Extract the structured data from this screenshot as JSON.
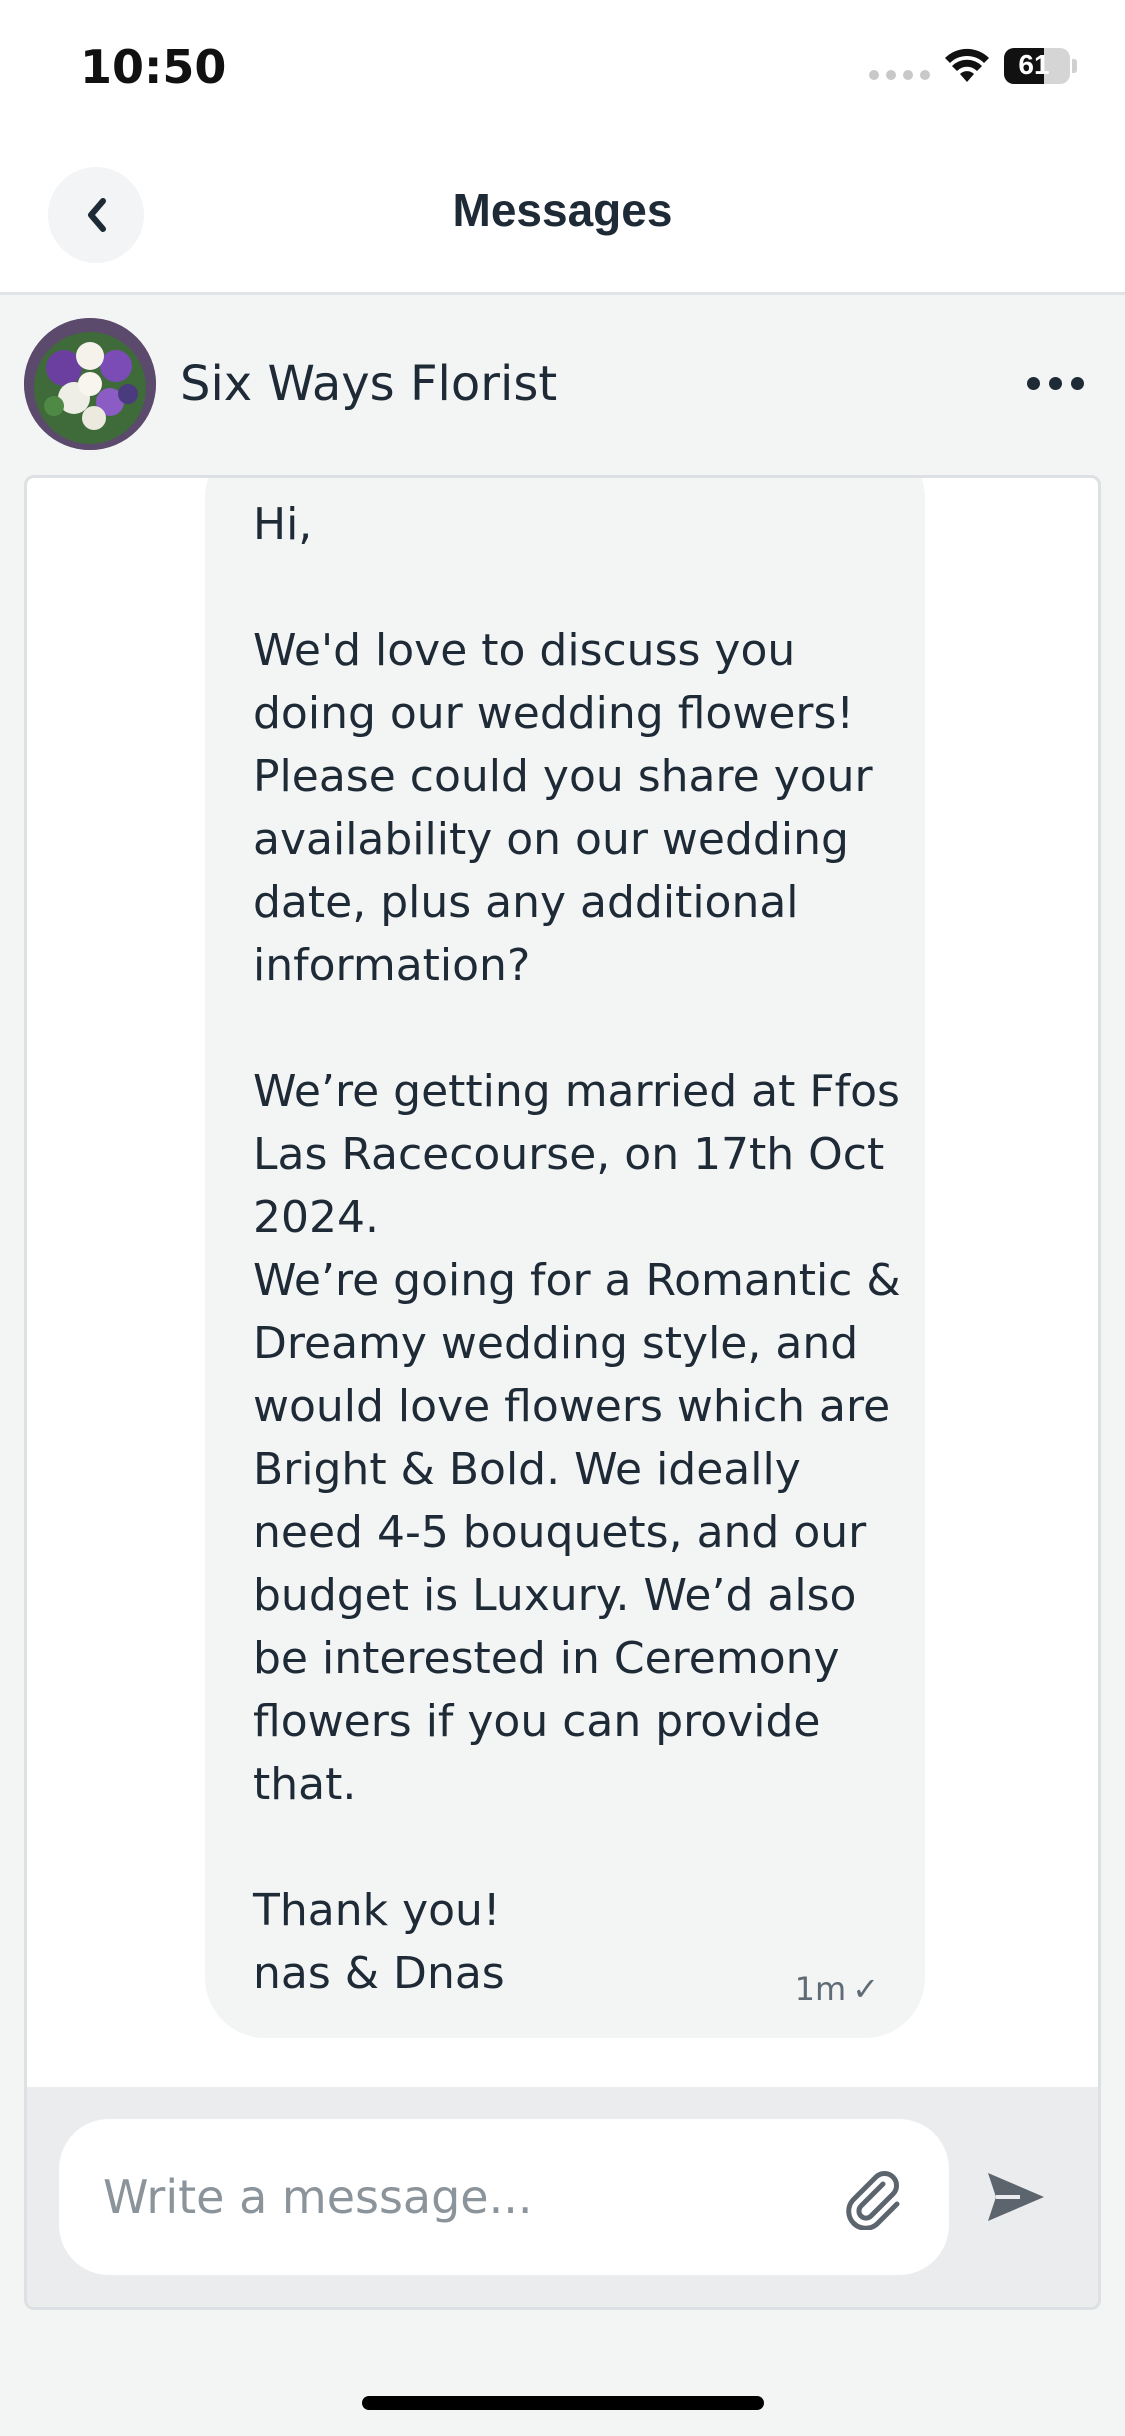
{
  "status_bar": {
    "time": "10:50",
    "battery_level": "61",
    "battery_fraction": 0.61,
    "icons": [
      "signal-icon",
      "wifi-icon",
      "battery-icon"
    ]
  },
  "header": {
    "title": "Messages",
    "back_icon": "chevron-left-icon"
  },
  "contact": {
    "name": "Six Ways Florist",
    "avatar": "florist-avatar",
    "more_icon": "more-horizontal-icon"
  },
  "message": {
    "text": "Hi,\n\nWe'd love to discuss you doing our wedding flowers! Please could you share your availability on our wedding date, plus any additional information?\n\nWe’re getting married at Ffos Las Racecourse, on 17th Oct 2024.\nWe’re going for a Romantic & Dreamy wedding style, and would love flowers which are Bright & Bold. We ideally need 4-5 bouquets, and our budget is Luxury. We’d also be interested in Ceremony flowers if you can provide that.\n\nThank you!\nnas & Dnas",
    "time": "1m",
    "status_mark": "✓"
  },
  "composer": {
    "placeholder": "Write a message...",
    "value": "",
    "attach_icon": "paperclip-icon",
    "send_icon": "send-icon"
  },
  "colors": {
    "text": "#1f2a37",
    "bubble": "#f3f5f5",
    "background": "#f3f5f5",
    "composer_bg": "#eaeced"
  }
}
